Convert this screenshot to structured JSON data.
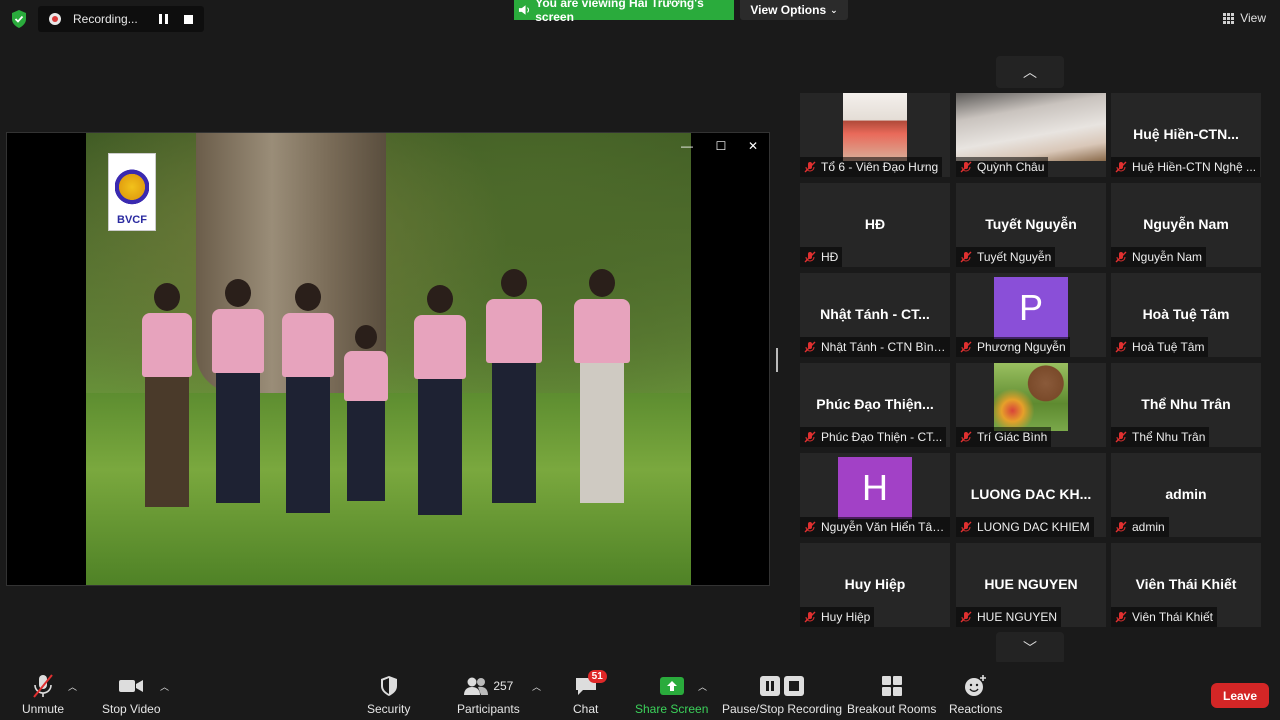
{
  "recording": {
    "label": "Recording..."
  },
  "banner": {
    "text": "You are viewing Hải Trường's screen"
  },
  "view_options": {
    "label": "View Options"
  },
  "view_button": {
    "label": "View"
  },
  "shared_video": {
    "logo_text": "BVCF"
  },
  "gallery": {
    "tiles": [
      {
        "name_label": "Tổ 6 - Viên Đạo Hưng",
        "big": "",
        "kind": "photo"
      },
      {
        "name_label": "Quỳnh Châu",
        "big": "",
        "kind": "photo"
      },
      {
        "name_label": "Huệ Hiền-CTN Nghệ ...",
        "big": "Huệ Hiền-CTN...",
        "kind": "text"
      },
      {
        "name_label": "HĐ",
        "big": "HĐ",
        "kind": "text"
      },
      {
        "name_label": "Tuyết Nguyễn",
        "big": "Tuyết Nguyễn",
        "kind": "text"
      },
      {
        "name_label": "Nguyễn Nam",
        "big": "Nguyễn Nam",
        "kind": "text"
      },
      {
        "name_label": "Nhật Tánh - CTN Bình...",
        "big": "Nhật Tánh - CT...",
        "kind": "text"
      },
      {
        "name_label": "Phương Nguyễn",
        "big": "P",
        "kind": "avatar",
        "color": "#8a4fd8"
      },
      {
        "name_label": "Hoà Tuệ Tâm",
        "big": "Hoà Tuệ Tâm",
        "kind": "text"
      },
      {
        "name_label": "Phúc Đạo Thiện - CT...",
        "big": "Phúc Đạo Thiện...",
        "kind": "text"
      },
      {
        "name_label": "Trí Giác Bình",
        "big": "",
        "kind": "photo"
      },
      {
        "name_label": "Thể Nhu Trân",
        "big": "Thể Nhu Trân",
        "kind": "text"
      },
      {
        "name_label": "Nguyễn Văn Hiển Tây...",
        "big": "H",
        "kind": "avatar",
        "color": "#a241c6"
      },
      {
        "name_label": "LUONG DAC KHIEM",
        "big": "LUONG DAC KH...",
        "kind": "text"
      },
      {
        "name_label": "admin",
        "big": "admin",
        "kind": "text"
      },
      {
        "name_label": "Huy Hiệp",
        "big": "Huy Hiệp",
        "kind": "text"
      },
      {
        "name_label": "HUE NGUYEN",
        "big": "HUE NGUYEN",
        "kind": "text"
      },
      {
        "name_label": "Viên Thái Khiết",
        "big": "Viên Thái Khiết",
        "kind": "text"
      }
    ]
  },
  "toolbar": {
    "unmute": "Unmute",
    "stop_video": "Stop Video",
    "security": "Security",
    "participants": "Participants",
    "participants_count": "257",
    "chat": "Chat",
    "chat_badge": "51",
    "share_screen": "Share Screen",
    "pause_stop_recording": "Pause/Stop Recording",
    "breakout_rooms": "Breakout Rooms",
    "reactions": "Reactions",
    "leave": "Leave"
  },
  "colors": {
    "share_green": "#2aab3c",
    "leave_red": "#d32626"
  }
}
